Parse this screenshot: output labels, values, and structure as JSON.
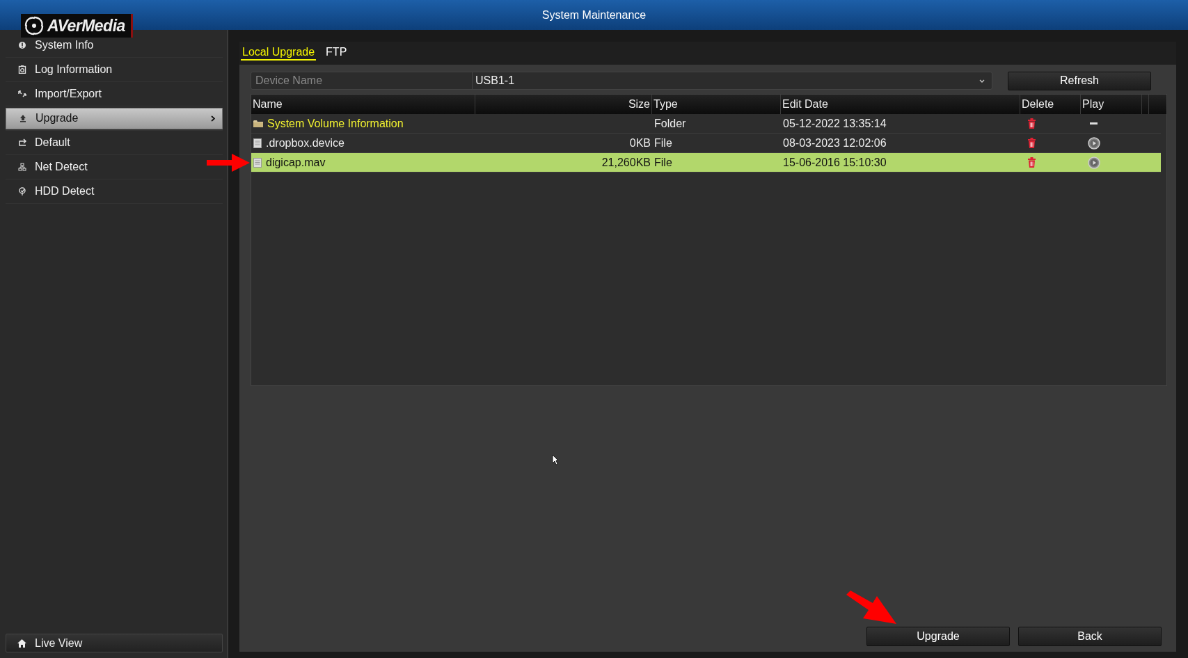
{
  "window": {
    "title": "System Maintenance",
    "logo": "AVerMedia"
  },
  "sidebar": {
    "items": [
      {
        "label": "System Info",
        "selected": false
      },
      {
        "label": "Log Information",
        "selected": false
      },
      {
        "label": "Import/Export",
        "selected": false
      },
      {
        "label": "Upgrade",
        "selected": true
      },
      {
        "label": "Default",
        "selected": false
      },
      {
        "label": "Net Detect",
        "selected": false
      },
      {
        "label": "HDD Detect",
        "selected": false
      }
    ],
    "footer": {
      "label": "Live View"
    }
  },
  "tabs": [
    {
      "label": "Local Upgrade",
      "selected": true
    },
    {
      "label": "FTP",
      "selected": false
    }
  ],
  "device": {
    "label": "Device Name",
    "value": "USB1-1",
    "refresh": "Refresh"
  },
  "table": {
    "columns": [
      "Name",
      "Size",
      "Type",
      "Edit Date",
      "Delete",
      "Play"
    ],
    "rows": [
      {
        "kind": "folder",
        "name": "System Volume Information",
        "type": "Folder",
        "date": "05-12-2022 13:35:14",
        "selected": false
      },
      {
        "kind": "file",
        "name": ".dropbox.device",
        "size": "0KB",
        "type": "File",
        "date": "08-03-2023 12:02:06",
        "selected": false
      },
      {
        "kind": "file",
        "name": "digicap.mav",
        "size": "21,260KB",
        "type": "File",
        "date": "15-06-2016 15:10:30",
        "selected": true
      }
    ]
  },
  "buttons": [
    "Upgrade",
    "Back"
  ]
}
